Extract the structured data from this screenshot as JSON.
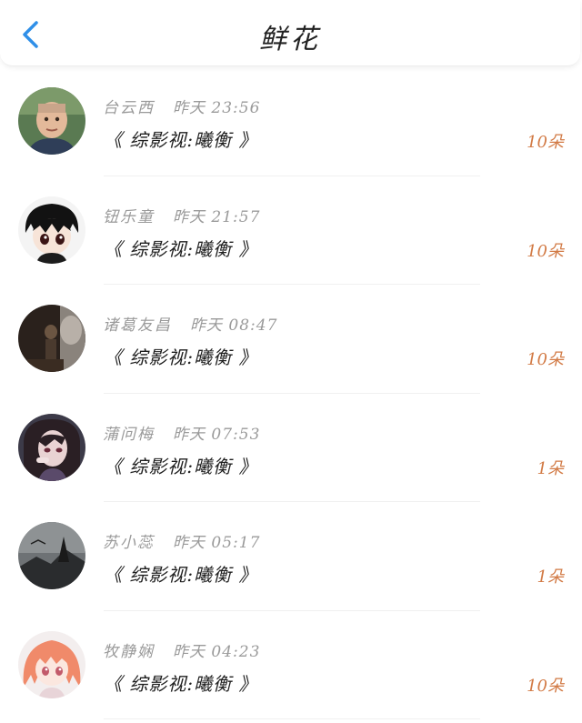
{
  "header": {
    "title": "鲜花",
    "back_icon": "chevron-left-icon",
    "accent_color": "#2f8fe8"
  },
  "gifts": [
    {
      "name": "台云西",
      "time": "昨天 23:56",
      "work": "《 综影视:曦衡 》",
      "count": "10朵",
      "avatar": "child-photo"
    },
    {
      "name": "钮乐童",
      "time": "昨天 21:57",
      "work": "《 综影视:曦衡 》",
      "count": "10朵",
      "avatar": "anime-boy"
    },
    {
      "name": "诸葛友昌",
      "time": "昨天 08:47",
      "work": "《 综影视:曦衡 》",
      "count": "10朵",
      "avatar": "dark-portrait"
    },
    {
      "name": "蒲问梅",
      "time": "昨天 07:53",
      "work": "《 综影视:曦衡 》",
      "count": "1朵",
      "avatar": "anime-girl-dark"
    },
    {
      "name": "苏小蕊",
      "time": "昨天 05:17",
      "work": "《 综影视:曦衡 》",
      "count": "1朵",
      "avatar": "misty-landscape"
    },
    {
      "name": "牧静娴",
      "time": "昨天 04:23",
      "work": "《 综影视:曦衡 》",
      "count": "10朵",
      "avatar": "anime-girl-pink"
    }
  ],
  "colors": {
    "count": "#d27a45",
    "meta": "#9a9a9a",
    "text": "#1e1e1e"
  }
}
